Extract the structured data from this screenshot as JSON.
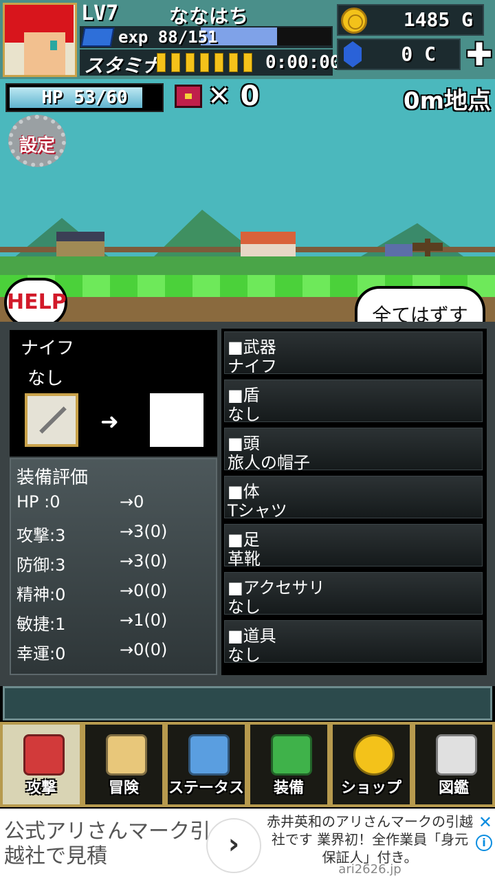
{
  "header": {
    "level": "LV7",
    "player_name": "ななはち",
    "exp_label": "exp 88/151",
    "exp_fraction": 0.583,
    "stamina_label": "スタミナ",
    "stamina_pips": 7,
    "stamina_timer": "0:00:00",
    "gold": "1485 G",
    "crystals": "0 C",
    "plus_label": "✚"
  },
  "scene": {
    "hp_label": "HP  53/60",
    "hp_fraction": 0.883,
    "chest_count": "✕ 0",
    "distance": "0m地点",
    "settings_label": "設定",
    "help_label": "HELP",
    "unequip_all_label": "全てはずす"
  },
  "preview": {
    "item_name": "ナイフ",
    "compare_name": "なし",
    "arrow": "➜"
  },
  "evaluation": {
    "title": "装備評価",
    "rows": [
      {
        "k": "HP  :0",
        "v": "→0"
      },
      {
        "k": "攻撃:3",
        "v": "→3(0)"
      },
      {
        "k": "防御:3",
        "v": "→3(0)"
      },
      {
        "k": "精神:0",
        "v": "→0(0)"
      },
      {
        "k": "敏捷:1",
        "v": "→1(0)"
      },
      {
        "k": "幸運:0",
        "v": "→0(0)"
      }
    ]
  },
  "slots": [
    {
      "cat": "■武器",
      "val": "ナイフ"
    },
    {
      "cat": "■盾",
      "val": "なし"
    },
    {
      "cat": "■頭",
      "val": "旅人の帽子"
    },
    {
      "cat": "■体",
      "val": "Tシャツ"
    },
    {
      "cat": "■足",
      "val": "革靴"
    },
    {
      "cat": "■アクセサリ",
      "val": "なし"
    },
    {
      "cat": "■道具",
      "val": "なし"
    }
  ],
  "nav": [
    {
      "label": "攻撃",
      "icon": "sword-icon",
      "color": "#d23a3a"
    },
    {
      "label": "冒険",
      "icon": "map-scroll-icon",
      "color": "#e8c77a"
    },
    {
      "label": "ステータス",
      "icon": "character-icon",
      "color": "#5a9ee0"
    },
    {
      "label": "装備",
      "icon": "equipment-icon",
      "color": "#3fb24a"
    },
    {
      "label": "ショップ",
      "icon": "coin-icon",
      "color": "#f3c21a"
    },
    {
      "label": "図鑑",
      "icon": "encyclopedia-icon",
      "color": "#e0e0e0"
    }
  ],
  "ad": {
    "headline": "公式アリさんマーク引越社で見積",
    "go": "›",
    "body": "赤井英和のアリさんマークの引越社です 業界初！全作業員「身元保証人」付き。",
    "url": "ari2626.jp",
    "close": "✕",
    "info": "i"
  }
}
